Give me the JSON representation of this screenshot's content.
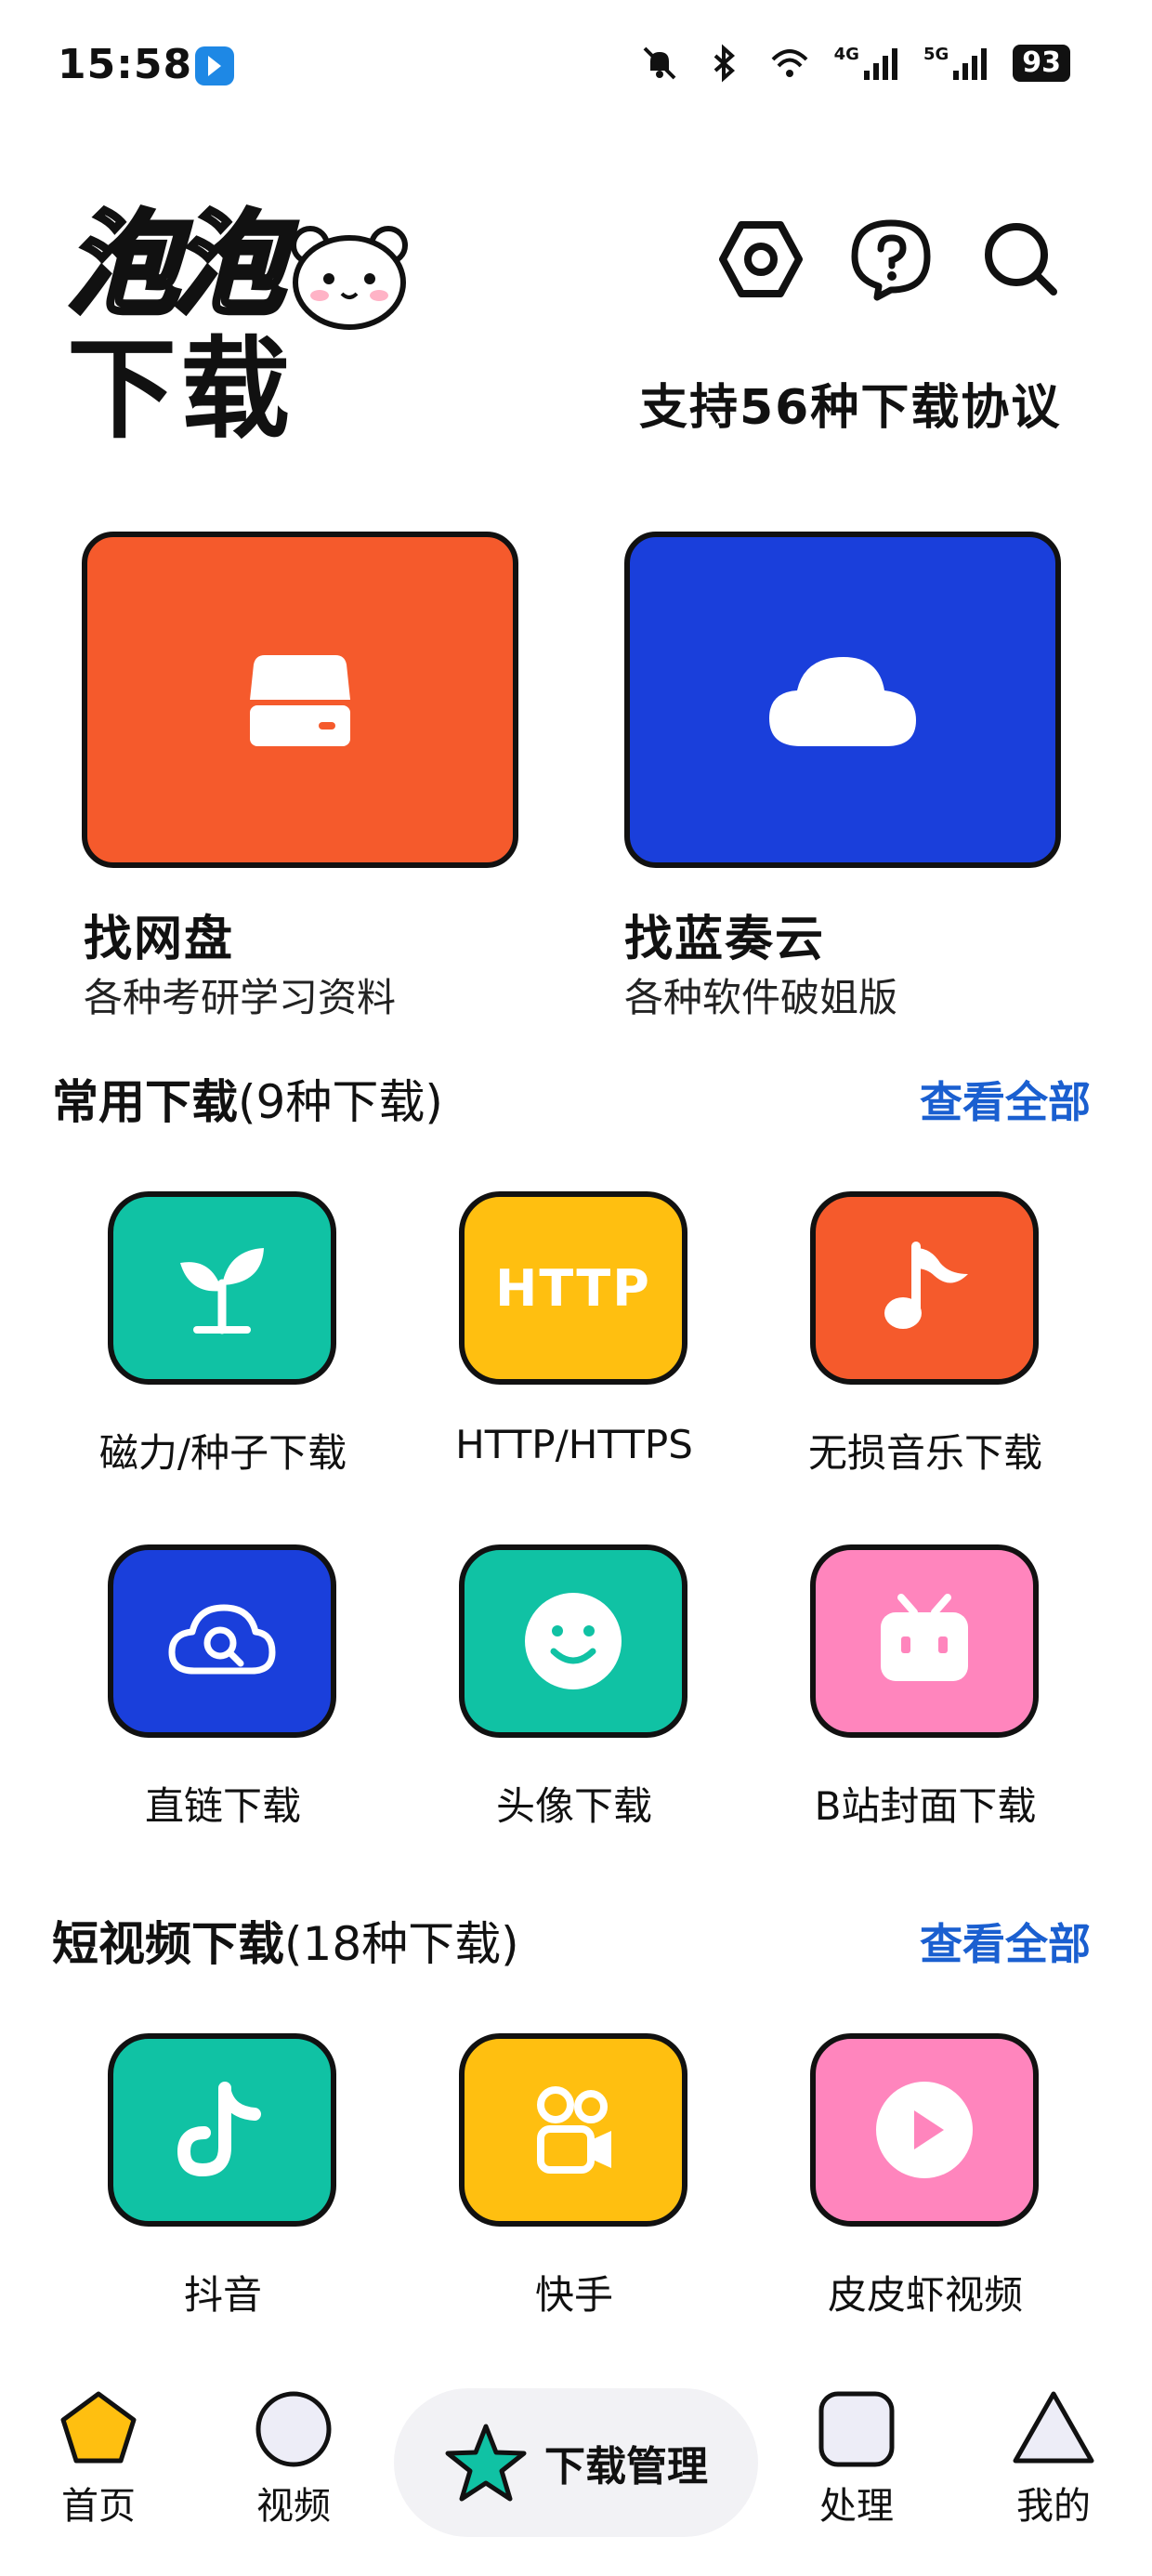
{
  "status_bar": {
    "time": "15:58",
    "network_4g": "4G",
    "network_5g": "5G",
    "battery": "93"
  },
  "header": {
    "logo_text": "泡泡",
    "title": "下载",
    "tagline": "支持56种下载协议",
    "icons": [
      "settings-icon",
      "help-icon",
      "search-icon"
    ]
  },
  "feature_cards": [
    {
      "title": "找网盘",
      "subtitle": "各种考研学习资料",
      "color": "#f55a2c",
      "icon": "drive-icon"
    },
    {
      "title": "找蓝奏云",
      "subtitle": "各种软件破姐版",
      "color": "#1a3fdb",
      "icon": "cloud-icon"
    }
  ],
  "common_section": {
    "title": "常用下载",
    "count": "(9种下载)",
    "see_all": "查看全部",
    "items": [
      {
        "label": "磁力/种子下载",
        "color": "#10c2a4",
        "icon": "sprout-icon"
      },
      {
        "label": "HTTP/HTTPS",
        "color": "#ffbf10",
        "icon": "http-icon",
        "icon_text": "HTTP"
      },
      {
        "label": "无损音乐下载",
        "color": "#f55a2c",
        "icon": "music-note-icon"
      },
      {
        "label": "直链下载",
        "color": "#1a3fdb",
        "icon": "cloud-search-icon"
      },
      {
        "label": "头像下载",
        "color": "#10c2a4",
        "icon": "smiley-icon"
      },
      {
        "label": "B站封面下载",
        "color": "#ff85bd",
        "icon": "bilibili-tv-icon"
      }
    ]
  },
  "short_video_section": {
    "title": "短视频下载",
    "count": "(18种下载)",
    "see_all": "查看全部",
    "items": [
      {
        "label": "抖音",
        "color": "#10c2a4",
        "icon": "douyin-icon"
      },
      {
        "label": "快手",
        "color": "#ffbf10",
        "icon": "kuaishou-icon"
      },
      {
        "label": "皮皮虾视频",
        "color": "#ff85bd",
        "icon": "play-icon"
      }
    ]
  },
  "bottom_nav": {
    "home": "首页",
    "video": "视频",
    "download_manager": "下载管理",
    "process": "处理",
    "mine": "我的"
  },
  "colors": {
    "accent_blue": "#1a5fd0",
    "orange": "#f55a2c",
    "blue": "#1a3fdb",
    "teal": "#10c2a4",
    "yellow": "#ffbf10",
    "pink": "#ff85bd"
  }
}
